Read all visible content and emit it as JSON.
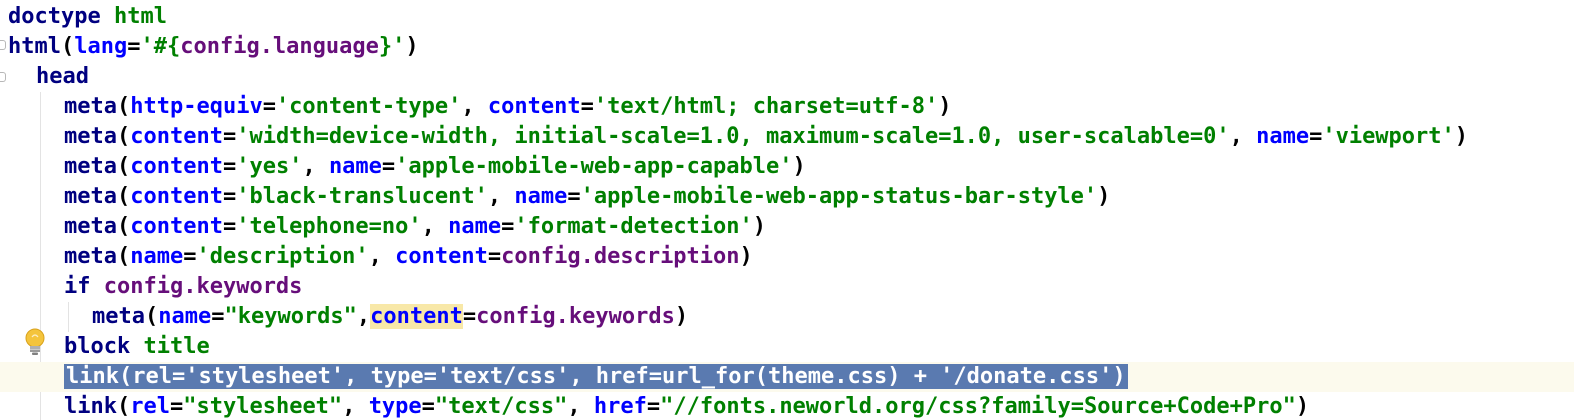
{
  "editor": {
    "lines": [
      {
        "parts": [
          {
            "t": "doctype ",
            "c": "kw"
          },
          {
            "t": "html",
            "c": "str"
          }
        ]
      },
      {
        "parts": [
          {
            "t": "html",
            "c": "kw"
          },
          {
            "t": "(",
            "c": "punc"
          },
          {
            "t": "lang",
            "c": "attr"
          },
          {
            "t": "=",
            "c": "punc"
          },
          {
            "t": "'#{",
            "c": "str"
          },
          {
            "t": "config.language",
            "c": "var"
          },
          {
            "t": "}'",
            "c": "str"
          },
          {
            "t": ")",
            "c": "punc"
          }
        ]
      },
      {
        "parts": [
          {
            "t": "head",
            "c": "kw"
          }
        ]
      },
      {
        "parts": [
          {
            "t": "meta",
            "c": "kw"
          },
          {
            "t": "(",
            "c": "punc"
          },
          {
            "t": "http-equiv",
            "c": "attr"
          },
          {
            "t": "=",
            "c": "punc"
          },
          {
            "t": "'content-type'",
            "c": "str"
          },
          {
            "t": ", ",
            "c": "punc"
          },
          {
            "t": "content",
            "c": "attr"
          },
          {
            "t": "=",
            "c": "punc"
          },
          {
            "t": "'text/html; charset=utf-8'",
            "c": "str"
          },
          {
            "t": ")",
            "c": "punc"
          }
        ]
      },
      {
        "parts": [
          {
            "t": "meta",
            "c": "kw"
          },
          {
            "t": "(",
            "c": "punc"
          },
          {
            "t": "content",
            "c": "attr"
          },
          {
            "t": "=",
            "c": "punc"
          },
          {
            "t": "'width=device-width, initial-scale=1.0, maximum-scale=1.0, user-scalable=0'",
            "c": "str"
          },
          {
            "t": ", ",
            "c": "punc"
          },
          {
            "t": "name",
            "c": "attr"
          },
          {
            "t": "=",
            "c": "punc"
          },
          {
            "t": "'viewport'",
            "c": "str"
          },
          {
            "t": ")",
            "c": "punc"
          }
        ]
      },
      {
        "parts": [
          {
            "t": "meta",
            "c": "kw"
          },
          {
            "t": "(",
            "c": "punc"
          },
          {
            "t": "content",
            "c": "attr"
          },
          {
            "t": "=",
            "c": "punc"
          },
          {
            "t": "'yes'",
            "c": "str"
          },
          {
            "t": ", ",
            "c": "punc"
          },
          {
            "t": "name",
            "c": "attr"
          },
          {
            "t": "=",
            "c": "punc"
          },
          {
            "t": "'apple-mobile-web-app-capable'",
            "c": "str"
          },
          {
            "t": ")",
            "c": "punc"
          }
        ]
      },
      {
        "parts": [
          {
            "t": "meta",
            "c": "kw"
          },
          {
            "t": "(",
            "c": "punc"
          },
          {
            "t": "content",
            "c": "attr"
          },
          {
            "t": "=",
            "c": "punc"
          },
          {
            "t": "'black-translucent'",
            "c": "str"
          },
          {
            "t": ", ",
            "c": "punc"
          },
          {
            "t": "name",
            "c": "attr"
          },
          {
            "t": "=",
            "c": "punc"
          },
          {
            "t": "'apple-mobile-web-app-status-bar-style'",
            "c": "str"
          },
          {
            "t": ")",
            "c": "punc"
          }
        ]
      },
      {
        "parts": [
          {
            "t": "meta",
            "c": "kw"
          },
          {
            "t": "(",
            "c": "punc"
          },
          {
            "t": "content",
            "c": "attr"
          },
          {
            "t": "=",
            "c": "punc"
          },
          {
            "t": "'telephone=no'",
            "c": "str"
          },
          {
            "t": ", ",
            "c": "punc"
          },
          {
            "t": "name",
            "c": "attr"
          },
          {
            "t": "=",
            "c": "punc"
          },
          {
            "t": "'format-detection'",
            "c": "str"
          },
          {
            "t": ")",
            "c": "punc"
          }
        ]
      },
      {
        "parts": [
          {
            "t": "meta",
            "c": "kw"
          },
          {
            "t": "(",
            "c": "punc"
          },
          {
            "t": "name",
            "c": "attr"
          },
          {
            "t": "=",
            "c": "punc"
          },
          {
            "t": "'description'",
            "c": "str"
          },
          {
            "t": ", ",
            "c": "punc"
          },
          {
            "t": "content",
            "c": "attr"
          },
          {
            "t": "=",
            "c": "punc"
          },
          {
            "t": "config.description",
            "c": "var"
          },
          {
            "t": ")",
            "c": "punc"
          }
        ]
      },
      {
        "parts": [
          {
            "t": "if ",
            "c": "kw"
          },
          {
            "t": "config.keywords",
            "c": "var"
          }
        ]
      },
      {
        "parts": [
          {
            "t": "meta",
            "c": "kw"
          },
          {
            "t": "(",
            "c": "punc"
          },
          {
            "t": "name",
            "c": "attr"
          },
          {
            "t": "=",
            "c": "punc"
          },
          {
            "t": "\"keywords\"",
            "c": "str"
          },
          {
            "t": ",",
            "c": "punc"
          },
          {
            "t": "content",
            "c": "attr match-brace"
          },
          {
            "t": "=",
            "c": "punc"
          },
          {
            "t": "config.keywords",
            "c": "var"
          },
          {
            "t": ")",
            "c": "punc"
          }
        ]
      },
      {
        "parts": [
          {
            "t": "block ",
            "c": "kw"
          },
          {
            "t": "title",
            "c": "str"
          }
        ]
      },
      {
        "parts": [
          {
            "t": "link(rel='stylesheet', type='text/css', href=url_for(theme.css) + '/donate.css')",
            "c": "sel"
          }
        ]
      },
      {
        "parts": [
          {
            "t": "link",
            "c": "kw"
          },
          {
            "t": "(",
            "c": "punc"
          },
          {
            "t": "rel",
            "c": "attr"
          },
          {
            "t": "=",
            "c": "punc"
          },
          {
            "t": "\"stylesheet\"",
            "c": "str"
          },
          {
            "t": ", ",
            "c": "punc"
          },
          {
            "t": "type",
            "c": "attr"
          },
          {
            "t": "=",
            "c": "punc"
          },
          {
            "t": "\"text/css\"",
            "c": "str"
          },
          {
            "t": ", ",
            "c": "punc"
          },
          {
            "t": "href",
            "c": "attr"
          },
          {
            "t": "=",
            "c": "punc"
          },
          {
            "t": "\"//fonts.neworld.org/css?family=Source+Code+Pro\"",
            "c": "str"
          },
          {
            "t": ")",
            "c": "punc"
          }
        ]
      }
    ],
    "colors": {
      "keyword": "#000080",
      "attribute": "#0000ff",
      "string": "#008000",
      "variable": "#660e7a",
      "selection": "#5a7ab0",
      "current_line": "#fcfaed"
    },
    "icons": {
      "intention": "lightbulb-icon"
    }
  }
}
